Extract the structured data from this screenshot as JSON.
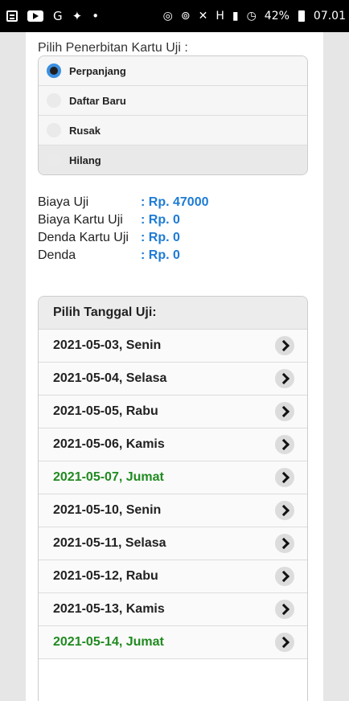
{
  "status_bar": {
    "left_icons": [
      "notes-icon",
      "youtube-icon",
      "google-icon",
      "twitter-icon",
      "dot-icon"
    ],
    "right_icons": [
      "data-saver-icon",
      "hotspot-icon",
      "mute-icon",
      "network-h-plus-icon",
      "signal-icon",
      "alarm-icon"
    ],
    "battery": "42%",
    "time": "07.01"
  },
  "penerbitan": {
    "label": "Pilih Penerbitan Kartu Uji :",
    "options": [
      {
        "label": "Perpanjang",
        "selected": true
      },
      {
        "label": "Daftar Baru",
        "selected": false
      },
      {
        "label": "Rusak",
        "selected": false
      },
      {
        "label": "Hilang",
        "selected": false
      }
    ]
  },
  "fees": [
    {
      "label": "Biaya Uji",
      "value": ": Rp. 47000"
    },
    {
      "label": "Biaya Kartu Uji",
      "value": ": Rp. 0"
    },
    {
      "label": "Denda Kartu Uji",
      "value": ": Rp. 0"
    },
    {
      "label": "Denda",
      "value": ": Rp. 0"
    }
  ],
  "tanggal": {
    "header": "Pilih Tanggal Uji:",
    "dates": [
      {
        "label": "2021-05-03, Senin",
        "highlight": false
      },
      {
        "label": "2021-05-04, Selasa",
        "highlight": false
      },
      {
        "label": "2021-05-05, Rabu",
        "highlight": false
      },
      {
        "label": "2021-05-06, Kamis",
        "highlight": false
      },
      {
        "label": "2021-05-07, Jumat",
        "highlight": true
      },
      {
        "label": "2021-05-10, Senin",
        "highlight": false
      },
      {
        "label": "2021-05-11, Selasa",
        "highlight": false
      },
      {
        "label": "2021-05-12, Rabu",
        "highlight": false
      },
      {
        "label": "2021-05-13, Kamis",
        "highlight": false
      },
      {
        "label": "2021-05-14, Jumat",
        "highlight": true
      }
    ],
    "highlight_color": "#208a20"
  }
}
